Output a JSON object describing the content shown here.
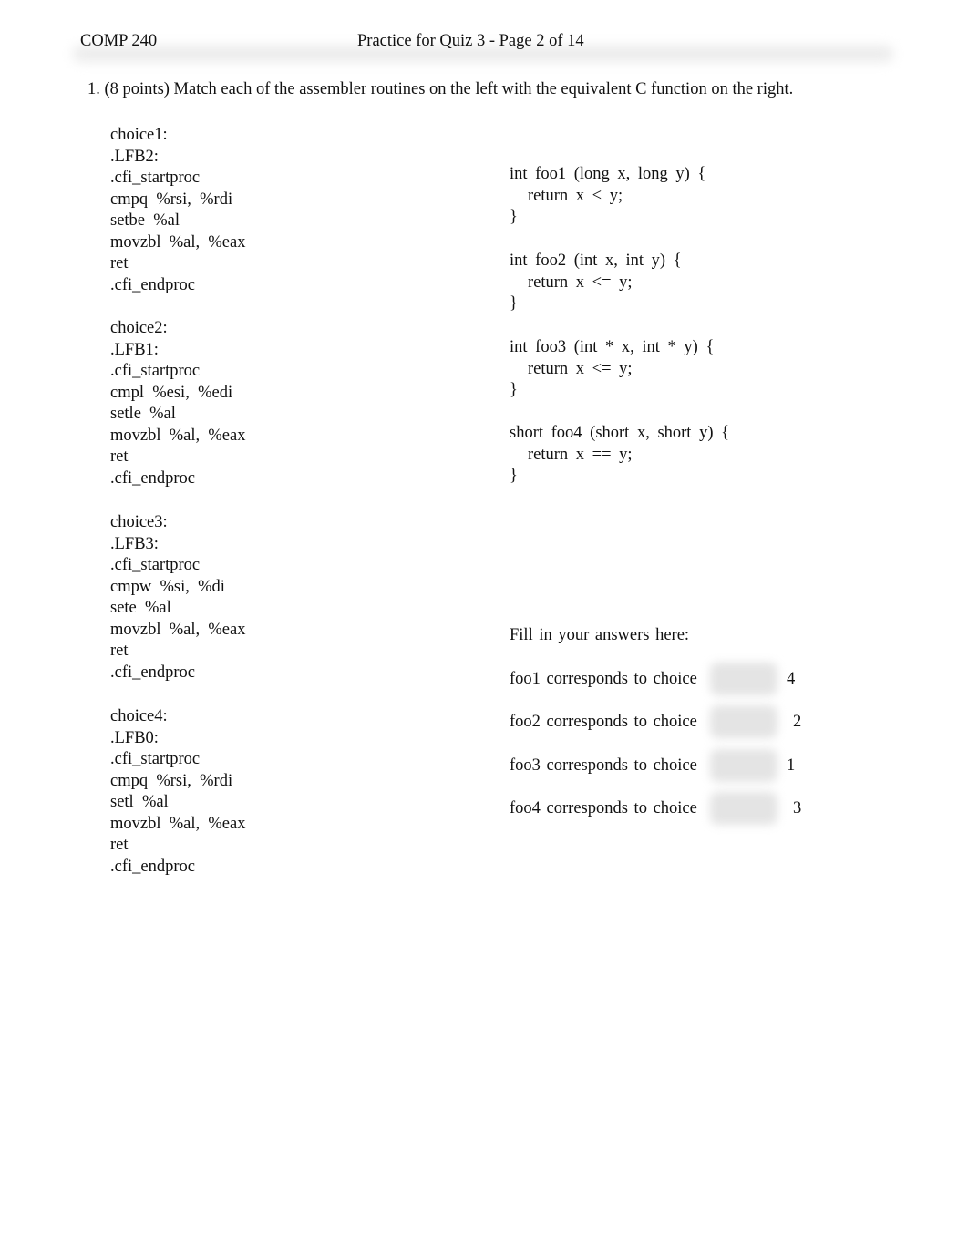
{
  "header": {
    "course": "COMP 240",
    "title": "Practice for Quiz 3 - Page 2 of 14"
  },
  "question": {
    "text": "1. (8 points) Match each of the assembler routines on the left with the equivalent C function on the right."
  },
  "assembler_choices": [
    {
      "lines": [
        "choice1:",
        ".LFB2:",
        ".cfi_startproc",
        "cmpq  %rsi,  %rdi",
        "setbe  %al",
        "movzbl  %al,  %eax",
        "ret",
        ".cfi_endproc"
      ]
    },
    {
      "lines": [
        "choice2:",
        ".LFB1:",
        ".cfi_startproc",
        "cmpl  %esi,  %edi",
        "setle  %al",
        "movzbl  %al,  %eax",
        "ret",
        ".cfi_endproc"
      ]
    },
    {
      "lines": [
        "choice3:",
        ".LFB3:",
        ".cfi_startproc",
        "cmpw  %si,  %di",
        "sete  %al",
        "movzbl  %al,  %eax",
        "ret",
        ".cfi_endproc"
      ]
    },
    {
      "lines": [
        "choice4:",
        ".LFB0:",
        ".cfi_startproc",
        "cmpq  %rsi,  %rdi",
        "setl  %al",
        "movzbl  %al,  %eax",
        "ret",
        ".cfi_endproc"
      ]
    }
  ],
  "c_functions": [
    {
      "signature": "int foo1 (long x, long y) {",
      "body": "return x < y;",
      "close": "}"
    },
    {
      "signature": "int foo2 (int x, int y) {",
      "body": "return x <= y;",
      "close": "}"
    },
    {
      "signature": "int foo3 (int * x, int * y) {",
      "body": "return x <= y;",
      "close": "}"
    },
    {
      "signature": "short foo4 (short x, short y) {",
      "body": "return x == y;",
      "close": "}"
    }
  ],
  "answers": {
    "title": "Fill in your answers here:",
    "rows": [
      {
        "label": "foo1 corresponds to choice",
        "value": "4"
      },
      {
        "label": "foo2 corresponds to choice",
        "value": "2"
      },
      {
        "label": "foo3 corresponds to choice",
        "value": "1"
      },
      {
        "label": "foo4 corresponds to choice",
        "value": "3"
      }
    ]
  }
}
